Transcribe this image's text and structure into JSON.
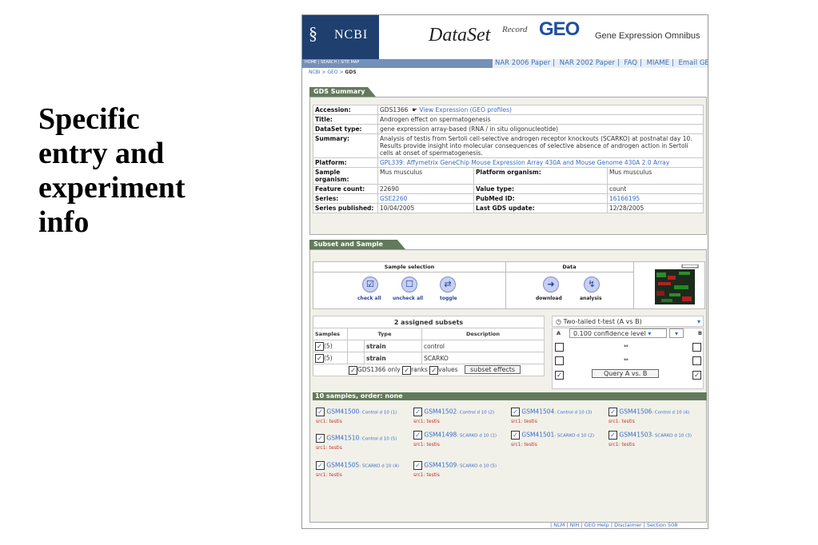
{
  "slide": {
    "title_lines": [
      "Specific",
      "entry and",
      "experiment",
      "info"
    ]
  },
  "banner": {
    "ncbi": "NCBI",
    "dataset": "DataSet",
    "record": "Record",
    "geo": "GEO",
    "geo_full": "Gene Expression Omnibus"
  },
  "nav": {
    "left": "HOME | SEARCH | SITE MAP",
    "links": [
      "NAR 2006 Paper",
      "NAR 2002 Paper",
      "FAQ",
      "MIAME",
      "Email GEO"
    ],
    "breadcrumb_prefix": "NCBI > GEO > ",
    "breadcrumb_current": "GDS"
  },
  "summary": {
    "tab": "GDS Summary",
    "accession_label": "Accession:",
    "accession": "GDS1366",
    "view_expression": "View Expression (GEO profiles)",
    "title_label": "Title:",
    "title": "Androgen effect on spermatogenesis",
    "type_label": "DataSet type:",
    "type": "gene expression array-based (RNA / in situ oligonucleotide)",
    "summary_label": "Summary:",
    "summary": "Analysis of testis from Sertoli cell-selective androgen receptor knockouts (SCARKO) at postnatal day 10. Results provide insight into molecular consequences of selective absence of androgen action in Sertoli cells at onset of spermatogenesis.",
    "platform_label": "Platform:",
    "platform": "GPL339: Affymetrix GeneChip Mouse Expression Array 430A and Mouse Genome 430A 2.0 Array",
    "organism_label": "Sample organism:",
    "organism": "Mus musculus",
    "platform_organism_label": "Platform organism:",
    "platform_organism": "Mus musculus",
    "feature_label": "Feature count:",
    "feature": "22690",
    "value_type_label": "Value type:",
    "value_type": "count",
    "series_label": "Series:",
    "series": "GSE2260",
    "pubmed_label": "PubMed ID:",
    "pubmed": "16166195",
    "published_label": "Series published:",
    "published": "10/04/2005",
    "last_update_label": "Last GDS update:",
    "last_update": "12/28/2005"
  },
  "subset": {
    "tab": "Subset and Sample Info",
    "selection_header": "Sample selection",
    "data_header": "Data",
    "check_all": "check all",
    "uncheck_all": "uncheck all",
    "toggle": "toggle",
    "download": "download",
    "analysis": "analysis",
    "assigned": "2 assigned subsets",
    "col_samples": "Samples",
    "col_type": "Type",
    "col_description": "Description",
    "rows": [
      {
        "count": "(5)",
        "type": "strain",
        "desc": "control"
      },
      {
        "count": "(5)",
        "type": "strain",
        "desc": "SCARKO"
      }
    ],
    "gds_only": "GDS1366 only",
    "ranks": "ranks",
    "values": "values",
    "subset_effects": "subset effects",
    "test_select": "Two-tailed t-test (A vs B)",
    "confidence_select": "0.100 confidence level",
    "col_a": "A",
    "col_b": "B",
    "arrow": "⇔",
    "query": "Query A vs. B"
  },
  "samples": {
    "header": "10 samples, order: none",
    "src_label": "src1:",
    "src_value": "testis",
    "items": [
      {
        "id": "GSM41500",
        "desc": ": Control d 10 (1)"
      },
      {
        "id": "GSM41502",
        "desc": ": Control d 10 (2)"
      },
      {
        "id": "GSM41504",
        "desc": ": Control d 10 (3)"
      },
      {
        "id": "GSM41506",
        "desc": ": Control d 10 (4)"
      },
      {
        "id": "GSM41510",
        "desc": ": Control d 10 (5)"
      },
      {
        "id": "GSM41498",
        "desc": ": SCARKO d 10 (1)"
      },
      {
        "id": "GSM41501",
        "desc": ": SCARKO d 10 (2)"
      },
      {
        "id": "GSM41503",
        "desc": ": SCARKO d 10 (3)"
      },
      {
        "id": "GSM41505",
        "desc": ": SCARKO d 10 (4)"
      },
      {
        "id": "GSM41509",
        "desc": ": SCARKO d 10 (5)"
      }
    ]
  },
  "footer": "| NLM | NIH | GEO Help | Disclaimer | Section 508"
}
